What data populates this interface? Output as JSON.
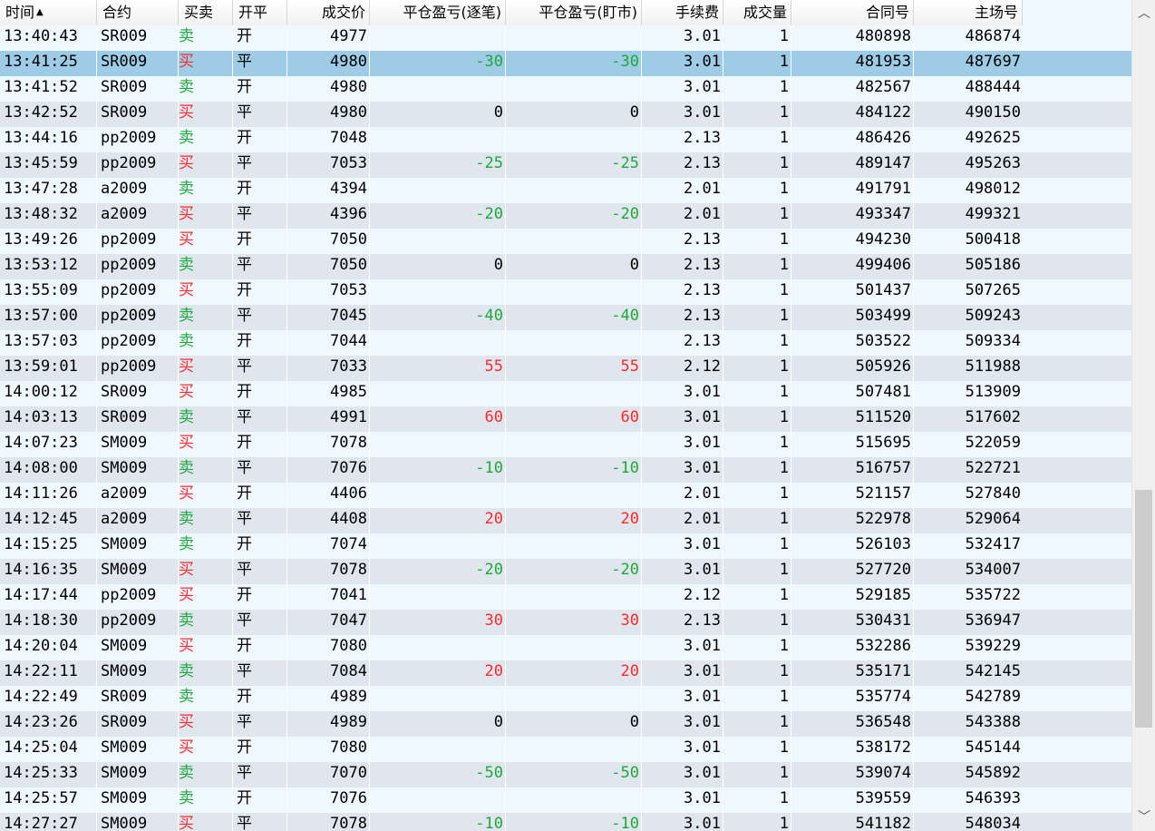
{
  "columns": [
    {
      "key": "time",
      "label": "时间",
      "w": 107,
      "align": "l"
    },
    {
      "key": "contract",
      "label": "合约",
      "w": 90,
      "align": "l"
    },
    {
      "key": "dir",
      "label": "买卖",
      "w": 60,
      "align": "l"
    },
    {
      "key": "oc",
      "label": "开平",
      "w": 60,
      "align": "l"
    },
    {
      "key": "price",
      "label": "成交价",
      "w": 91,
      "align": "r"
    },
    {
      "key": "pnl_trade",
      "label": "平仓盈亏(逐笔)",
      "w": 150,
      "align": "r"
    },
    {
      "key": "pnl_mark",
      "label": "平仓盈亏(盯市)",
      "w": 150,
      "align": "r"
    },
    {
      "key": "fee",
      "label": "手续费",
      "w": 90,
      "align": "r"
    },
    {
      "key": "qty",
      "label": "成交量",
      "w": 75,
      "align": "r"
    },
    {
      "key": "contract_no",
      "label": "合同号",
      "w": 135,
      "align": "r"
    },
    {
      "key": "main_no",
      "label": "主场号",
      "w": 120,
      "align": "r"
    }
  ],
  "sort": {
    "column": "time",
    "indicator": "▲"
  },
  "selected_row": 1,
  "scroll": {
    "up": "︿",
    "down": "﹀",
    "position": 0.74
  },
  "rows": [
    [
      "13:40:43",
      "SR009",
      "卖",
      "开",
      "4977",
      "",
      "",
      "3.01",
      "1",
      "480898",
      "486874"
    ],
    [
      "13:41:25",
      "SR009",
      "买",
      "平",
      "4980",
      "-30",
      "-30",
      "3.01",
      "1",
      "481953",
      "487697"
    ],
    [
      "13:41:52",
      "SR009",
      "卖",
      "开",
      "4980",
      "",
      "",
      "3.01",
      "1",
      "482567",
      "488444"
    ],
    [
      "13:42:52",
      "SR009",
      "买",
      "平",
      "4980",
      "0",
      "0",
      "3.01",
      "1",
      "484122",
      "490150"
    ],
    [
      "13:44:16",
      "pp2009",
      "卖",
      "开",
      "7048",
      "",
      "",
      "2.13",
      "1",
      "486426",
      "492625"
    ],
    [
      "13:45:59",
      "pp2009",
      "买",
      "平",
      "7053",
      "-25",
      "-25",
      "2.13",
      "1",
      "489147",
      "495263"
    ],
    [
      "13:47:28",
      "a2009",
      "卖",
      "开",
      "4394",
      "",
      "",
      "2.01",
      "1",
      "491791",
      "498012"
    ],
    [
      "13:48:32",
      "a2009",
      "买",
      "平",
      "4396",
      "-20",
      "-20",
      "2.01",
      "1",
      "493347",
      "499321"
    ],
    [
      "13:49:26",
      "pp2009",
      "买",
      "开",
      "7050",
      "",
      "",
      "2.13",
      "1",
      "494230",
      "500418"
    ],
    [
      "13:53:12",
      "pp2009",
      "卖",
      "平",
      "7050",
      "0",
      "0",
      "2.13",
      "1",
      "499406",
      "505186"
    ],
    [
      "13:55:09",
      "pp2009",
      "买",
      "开",
      "7053",
      "",
      "",
      "2.13",
      "1",
      "501437",
      "507265"
    ],
    [
      "13:57:00",
      "pp2009",
      "卖",
      "平",
      "7045",
      "-40",
      "-40",
      "2.13",
      "1",
      "503499",
      "509243"
    ],
    [
      "13:57:03",
      "pp2009",
      "卖",
      "开",
      "7044",
      "",
      "",
      "2.13",
      "1",
      "503522",
      "509334"
    ],
    [
      "13:59:01",
      "pp2009",
      "买",
      "平",
      "7033",
      "55",
      "55",
      "2.12",
      "1",
      "505926",
      "511988"
    ],
    [
      "14:00:12",
      "SR009",
      "买",
      "开",
      "4985",
      "",
      "",
      "3.01",
      "1",
      "507481",
      "513909"
    ],
    [
      "14:03:13",
      "SR009",
      "卖",
      "平",
      "4991",
      "60",
      "60",
      "3.01",
      "1",
      "511520",
      "517602"
    ],
    [
      "14:07:23",
      "SM009",
      "买",
      "开",
      "7078",
      "",
      "",
      "3.01",
      "1",
      "515695",
      "522059"
    ],
    [
      "14:08:00",
      "SM009",
      "卖",
      "平",
      "7076",
      "-10",
      "-10",
      "3.01",
      "1",
      "516757",
      "522721"
    ],
    [
      "14:11:26",
      "a2009",
      "买",
      "开",
      "4406",
      "",
      "",
      "2.01",
      "1",
      "521157",
      "527840"
    ],
    [
      "14:12:45",
      "a2009",
      "卖",
      "平",
      "4408",
      "20",
      "20",
      "2.01",
      "1",
      "522978",
      "529064"
    ],
    [
      "14:15:25",
      "SM009",
      "卖",
      "开",
      "7074",
      "",
      "",
      "3.01",
      "1",
      "526103",
      "532417"
    ],
    [
      "14:16:35",
      "SM009",
      "买",
      "平",
      "7078",
      "-20",
      "-20",
      "3.01",
      "1",
      "527720",
      "534007"
    ],
    [
      "14:17:44",
      "pp2009",
      "买",
      "开",
      "7041",
      "",
      "",
      "2.12",
      "1",
      "529185",
      "535722"
    ],
    [
      "14:18:30",
      "pp2009",
      "卖",
      "平",
      "7047",
      "30",
      "30",
      "2.13",
      "1",
      "530431",
      "536947"
    ],
    [
      "14:20:04",
      "SM009",
      "买",
      "开",
      "7080",
      "",
      "",
      "3.01",
      "1",
      "532286",
      "539229"
    ],
    [
      "14:22:11",
      "SM009",
      "卖",
      "平",
      "7084",
      "20",
      "20",
      "3.01",
      "1",
      "535171",
      "542145"
    ],
    [
      "14:22:49",
      "SR009",
      "卖",
      "开",
      "4989",
      "",
      "",
      "3.01",
      "1",
      "535774",
      "542789"
    ],
    [
      "14:23:26",
      "SR009",
      "买",
      "平",
      "4989",
      "0",
      "0",
      "3.01",
      "1",
      "536548",
      "543388"
    ],
    [
      "14:25:04",
      "SM009",
      "买",
      "开",
      "7080",
      "",
      "",
      "3.01",
      "1",
      "538172",
      "545144"
    ],
    [
      "14:25:33",
      "SM009",
      "卖",
      "平",
      "7070",
      "-50",
      "-50",
      "3.01",
      "1",
      "539074",
      "545892"
    ],
    [
      "14:25:57",
      "SM009",
      "卖",
      "开",
      "7076",
      "",
      "",
      "3.01",
      "1",
      "539559",
      "546393"
    ],
    [
      "14:27:27",
      "SM009",
      "买",
      "平",
      "7078",
      "-10",
      "-10",
      "3.01",
      "1",
      "541182",
      "548034"
    ]
  ]
}
